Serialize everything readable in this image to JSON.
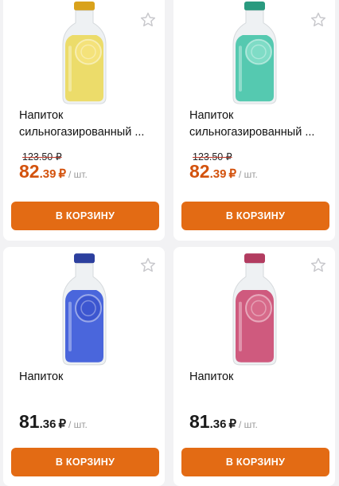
{
  "products": [
    {
      "name_line1": "Напиток",
      "name_line2": "сильногазированный ...",
      "old_price": "123.50 ₽",
      "price_int": "82",
      "price_frac": ".39",
      "currency": "₽",
      "unit": "/ шт.",
      "cart_label": "В КОРЗИНУ",
      "liquid_color": "#ecdc6a",
      "cap_color": "#d9a21b",
      "slice_color": "#f4e27a"
    },
    {
      "name_line1": "Напиток",
      "name_line2": "сильногазированный ...",
      "old_price": "123.50 ₽",
      "price_int": "82",
      "price_frac": ".39",
      "currency": "₽",
      "unit": "/ шт.",
      "cart_label": "В КОРЗИНУ",
      "liquid_color": "#55c9b0",
      "cap_color": "#2a9a7f",
      "slice_color": "#7fdcc6"
    },
    {
      "name_line1": "Напиток",
      "name_line2": "",
      "old_price": "",
      "price_int": "81",
      "price_frac": ".36",
      "currency": "₽",
      "unit": "/ шт.",
      "cart_label": "В КОРЗИНУ",
      "liquid_color": "#4a66dc",
      "cap_color": "#2c3f9e",
      "slice_color": "#3c56d0"
    },
    {
      "name_line1": "Напиток",
      "name_line2": "",
      "old_price": "",
      "price_int": "81",
      "price_frac": ".36",
      "currency": "₽",
      "unit": "/ шт.",
      "cart_label": "В КОРЗИНУ",
      "liquid_color": "#cf5a7e",
      "cap_color": "#b23c60",
      "slice_color": "#d76a8a"
    }
  ]
}
